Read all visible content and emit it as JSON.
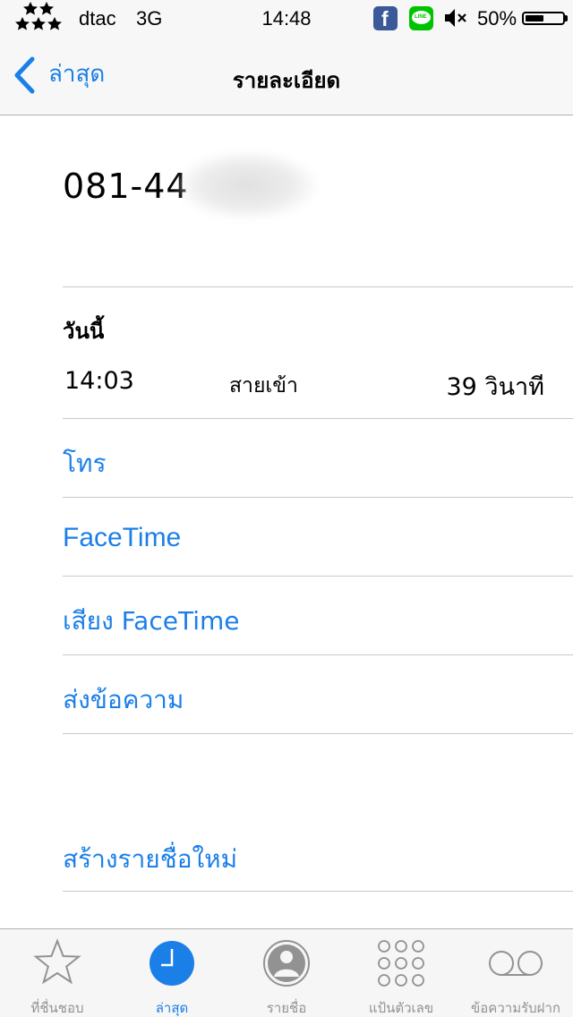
{
  "status_bar": {
    "carrier": "dtac",
    "network": "3G",
    "time": "14:48",
    "battery_percent_label": "50%",
    "battery_level": 0.5,
    "icons": [
      "stars-icon",
      "facebook-icon",
      "line-icon",
      "mute-icon",
      "battery-icon"
    ]
  },
  "nav": {
    "back_label": "ล่าสุด",
    "title": "รายละเอียด"
  },
  "contact": {
    "phone_number_visible": "081-44"
  },
  "call_log": {
    "section": "วันนี้",
    "entries": [
      {
        "time": "14:03",
        "type": "สายเข้า",
        "duration": "39 วินาที"
      }
    ]
  },
  "actions": {
    "call": "โทร",
    "facetime": "FaceTime",
    "facetime_audio": "เสียง FaceTime",
    "send_message": "ส่งข้อความ",
    "create_new_contact": "สร้างรายชื่อใหม่"
  },
  "tabs": [
    {
      "label": "ที่ชื่นชอบ",
      "icon": "star-icon",
      "active": false
    },
    {
      "label": "ล่าสุด",
      "icon": "clock-icon",
      "active": true
    },
    {
      "label": "รายชื่อ",
      "icon": "contact-icon",
      "active": false
    },
    {
      "label": "แป้นตัวเลข",
      "icon": "keypad-icon",
      "active": false
    },
    {
      "label": "ข้อความรับฝาก",
      "icon": "voicemail-icon",
      "active": false
    }
  ],
  "colors": {
    "accent": "#1b7fe8",
    "bar_background": "#f7f7f7",
    "separator": "#c8c7cc",
    "inactive_tab": "#929292"
  }
}
